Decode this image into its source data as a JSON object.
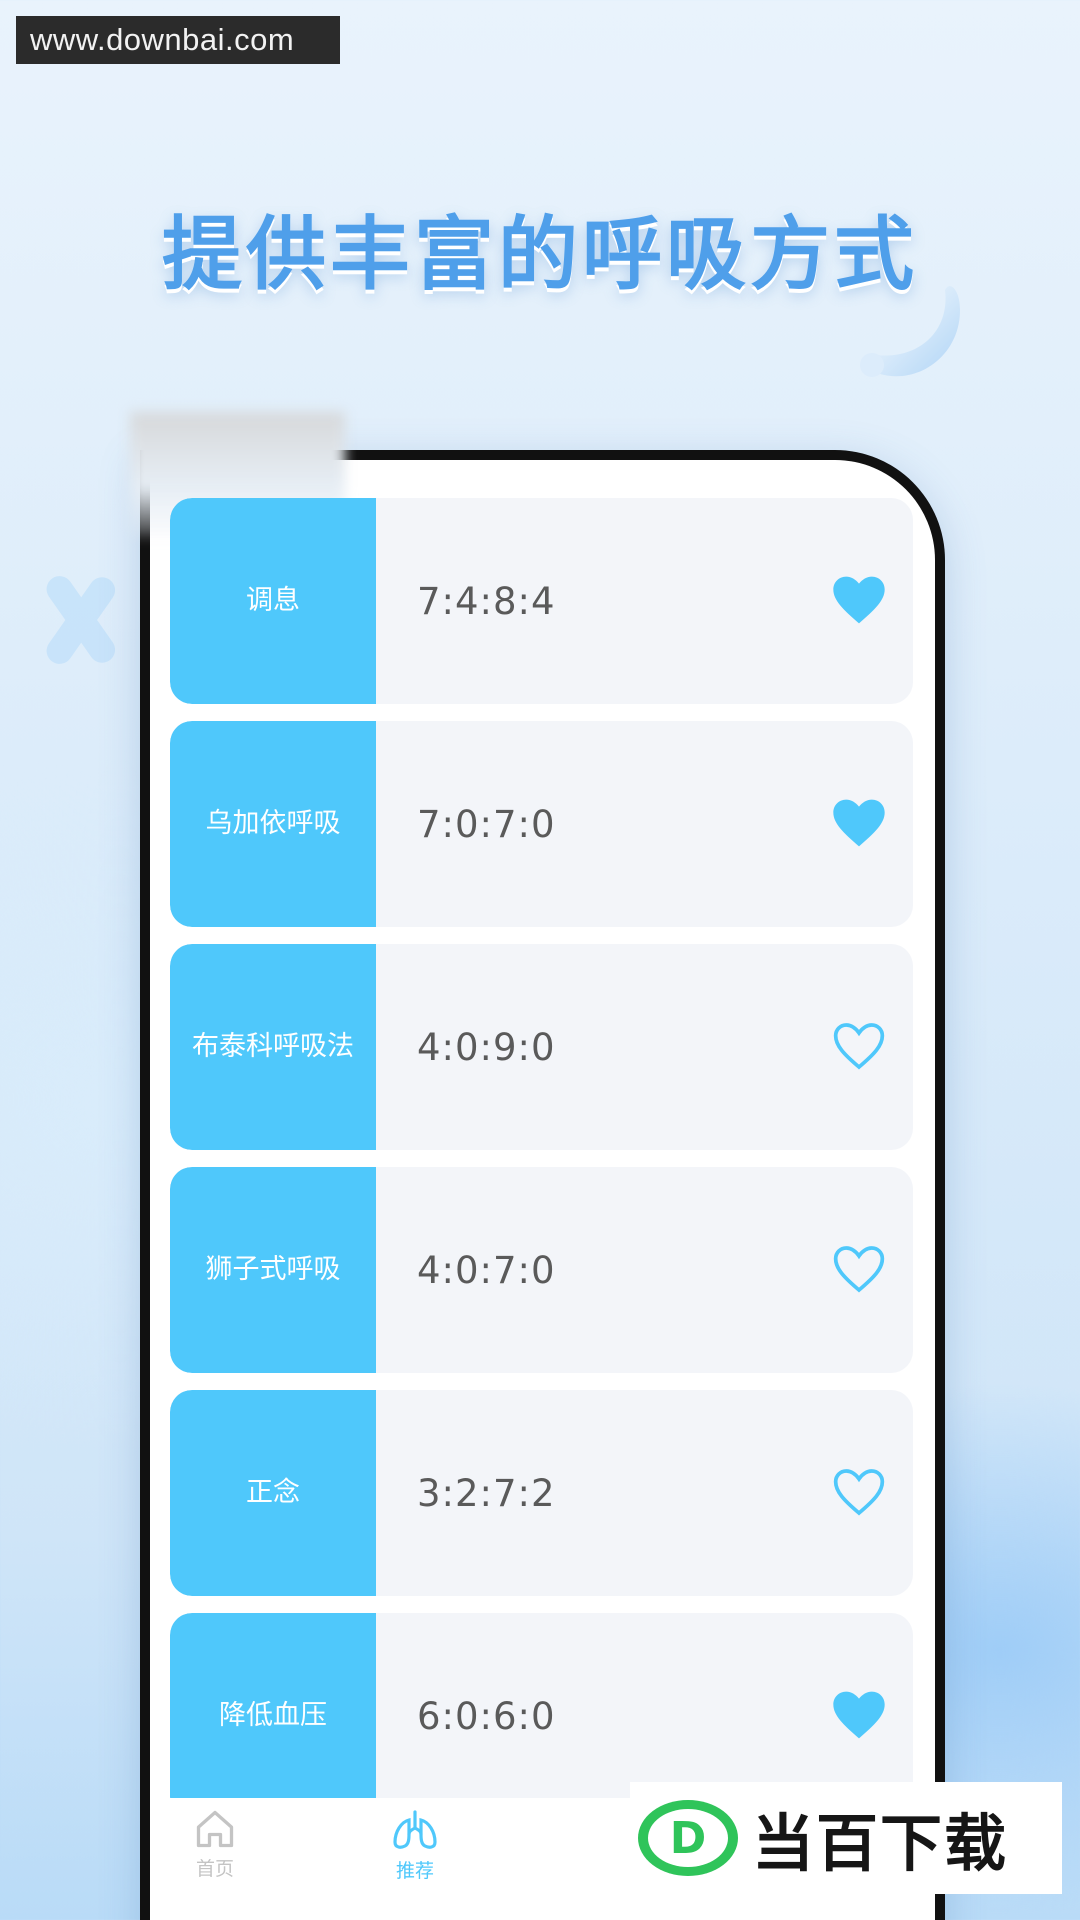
{
  "watermark": {
    "url": "www.downbai.com"
  },
  "headline": "提供丰富的呼吸方式",
  "breathing_methods": [
    {
      "name": "调息",
      "ratio": "7:4:8:4",
      "favorited": true
    },
    {
      "name": "乌加依呼吸",
      "ratio": "7:0:7:0",
      "favorited": true
    },
    {
      "name": "布泰科呼吸法",
      "ratio": "4:0:9:0",
      "favorited": false
    },
    {
      "name": "狮子式呼吸",
      "ratio": "4:0:7:0",
      "favorited": false
    },
    {
      "name": "正念",
      "ratio": "3:2:7:2",
      "favorited": false
    },
    {
      "name": "降低血压",
      "ratio": "6:0:6:0",
      "favorited": true
    }
  ],
  "tabs": [
    {
      "label": "首页",
      "icon": "home-icon",
      "active": false
    },
    {
      "label": "推荐",
      "icon": "lungs-icon",
      "active": true
    }
  ],
  "brand": {
    "name": "当百下载",
    "logo_letter": "D"
  },
  "colors": {
    "accent": "#4fc8fb",
    "headline": "#4f9fea",
    "card_bg": "#f3f5f9",
    "brand_green": "#2fc45a"
  }
}
